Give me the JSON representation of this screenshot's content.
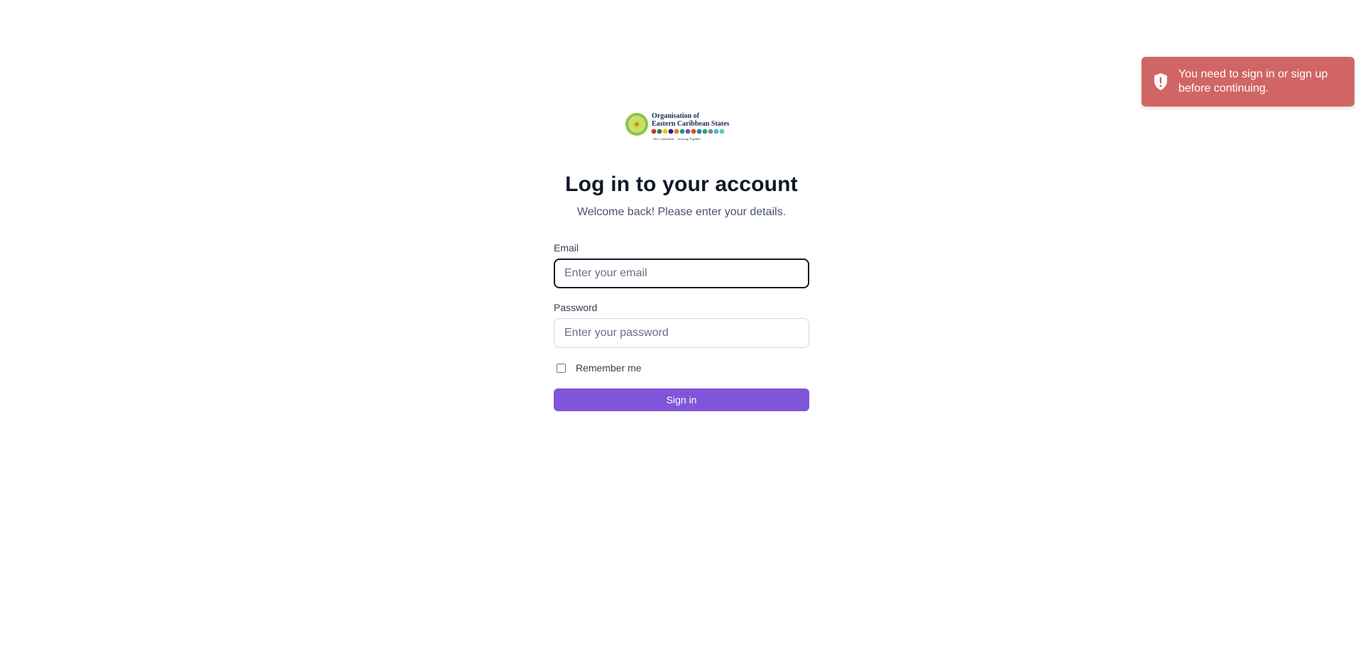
{
  "toast": {
    "message": "You need to sign in or sign up before continuing.",
    "icon": "shield-alert-icon",
    "color": "#d16565"
  },
  "logo": {
    "line1": "Organisation of",
    "line2": "Eastern Caribbean States",
    "tagline": "One Community · Growing Together"
  },
  "login": {
    "title": "Log in to your account",
    "subtitle": "Welcome back! Please enter your details.",
    "email_label": "Email",
    "email_placeholder": "Enter your email",
    "email_value": "",
    "password_label": "Password",
    "password_placeholder": "Enter your password",
    "password_value": "",
    "remember_label": "Remember me",
    "remember_checked": false,
    "signin_label": "Sign in",
    "accent_color": "#7f56d9"
  }
}
